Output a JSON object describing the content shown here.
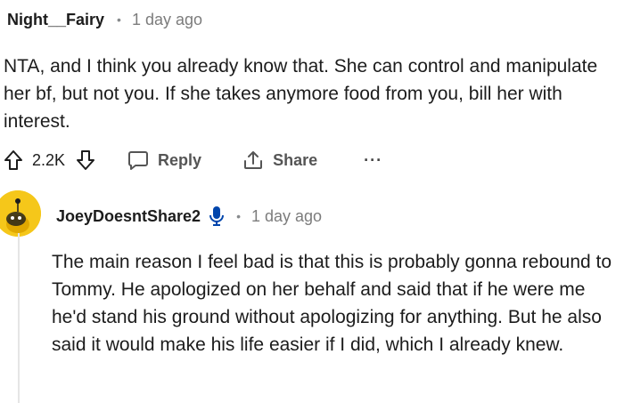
{
  "comment1": {
    "username": "Night__Fairy",
    "separator": "•",
    "time": "1 day ago",
    "body": "NTA, and I think you already know that. She can control and manipulate her bf, but not you. If she takes anymore food from you, bill her with interest.",
    "votes": "2.2K",
    "reply_label": "Reply",
    "share_label": "Share",
    "more_label": "···"
  },
  "comment2": {
    "username": "JoeyDoesntShare2",
    "separator": "•",
    "time": "1 day ago",
    "body": "The main reason I feel bad is that this is probably gonna rebound to Tommy. He apologized on her behalf and said that if he were me he'd stand his ground without apologizing for anything. But he also said it would make his life easier if I did, which I already knew."
  },
  "colors": {
    "avatar_bg": "#f5c71a",
    "accent_blue": "#0045ac",
    "muted_text": "#7c7c7c"
  }
}
